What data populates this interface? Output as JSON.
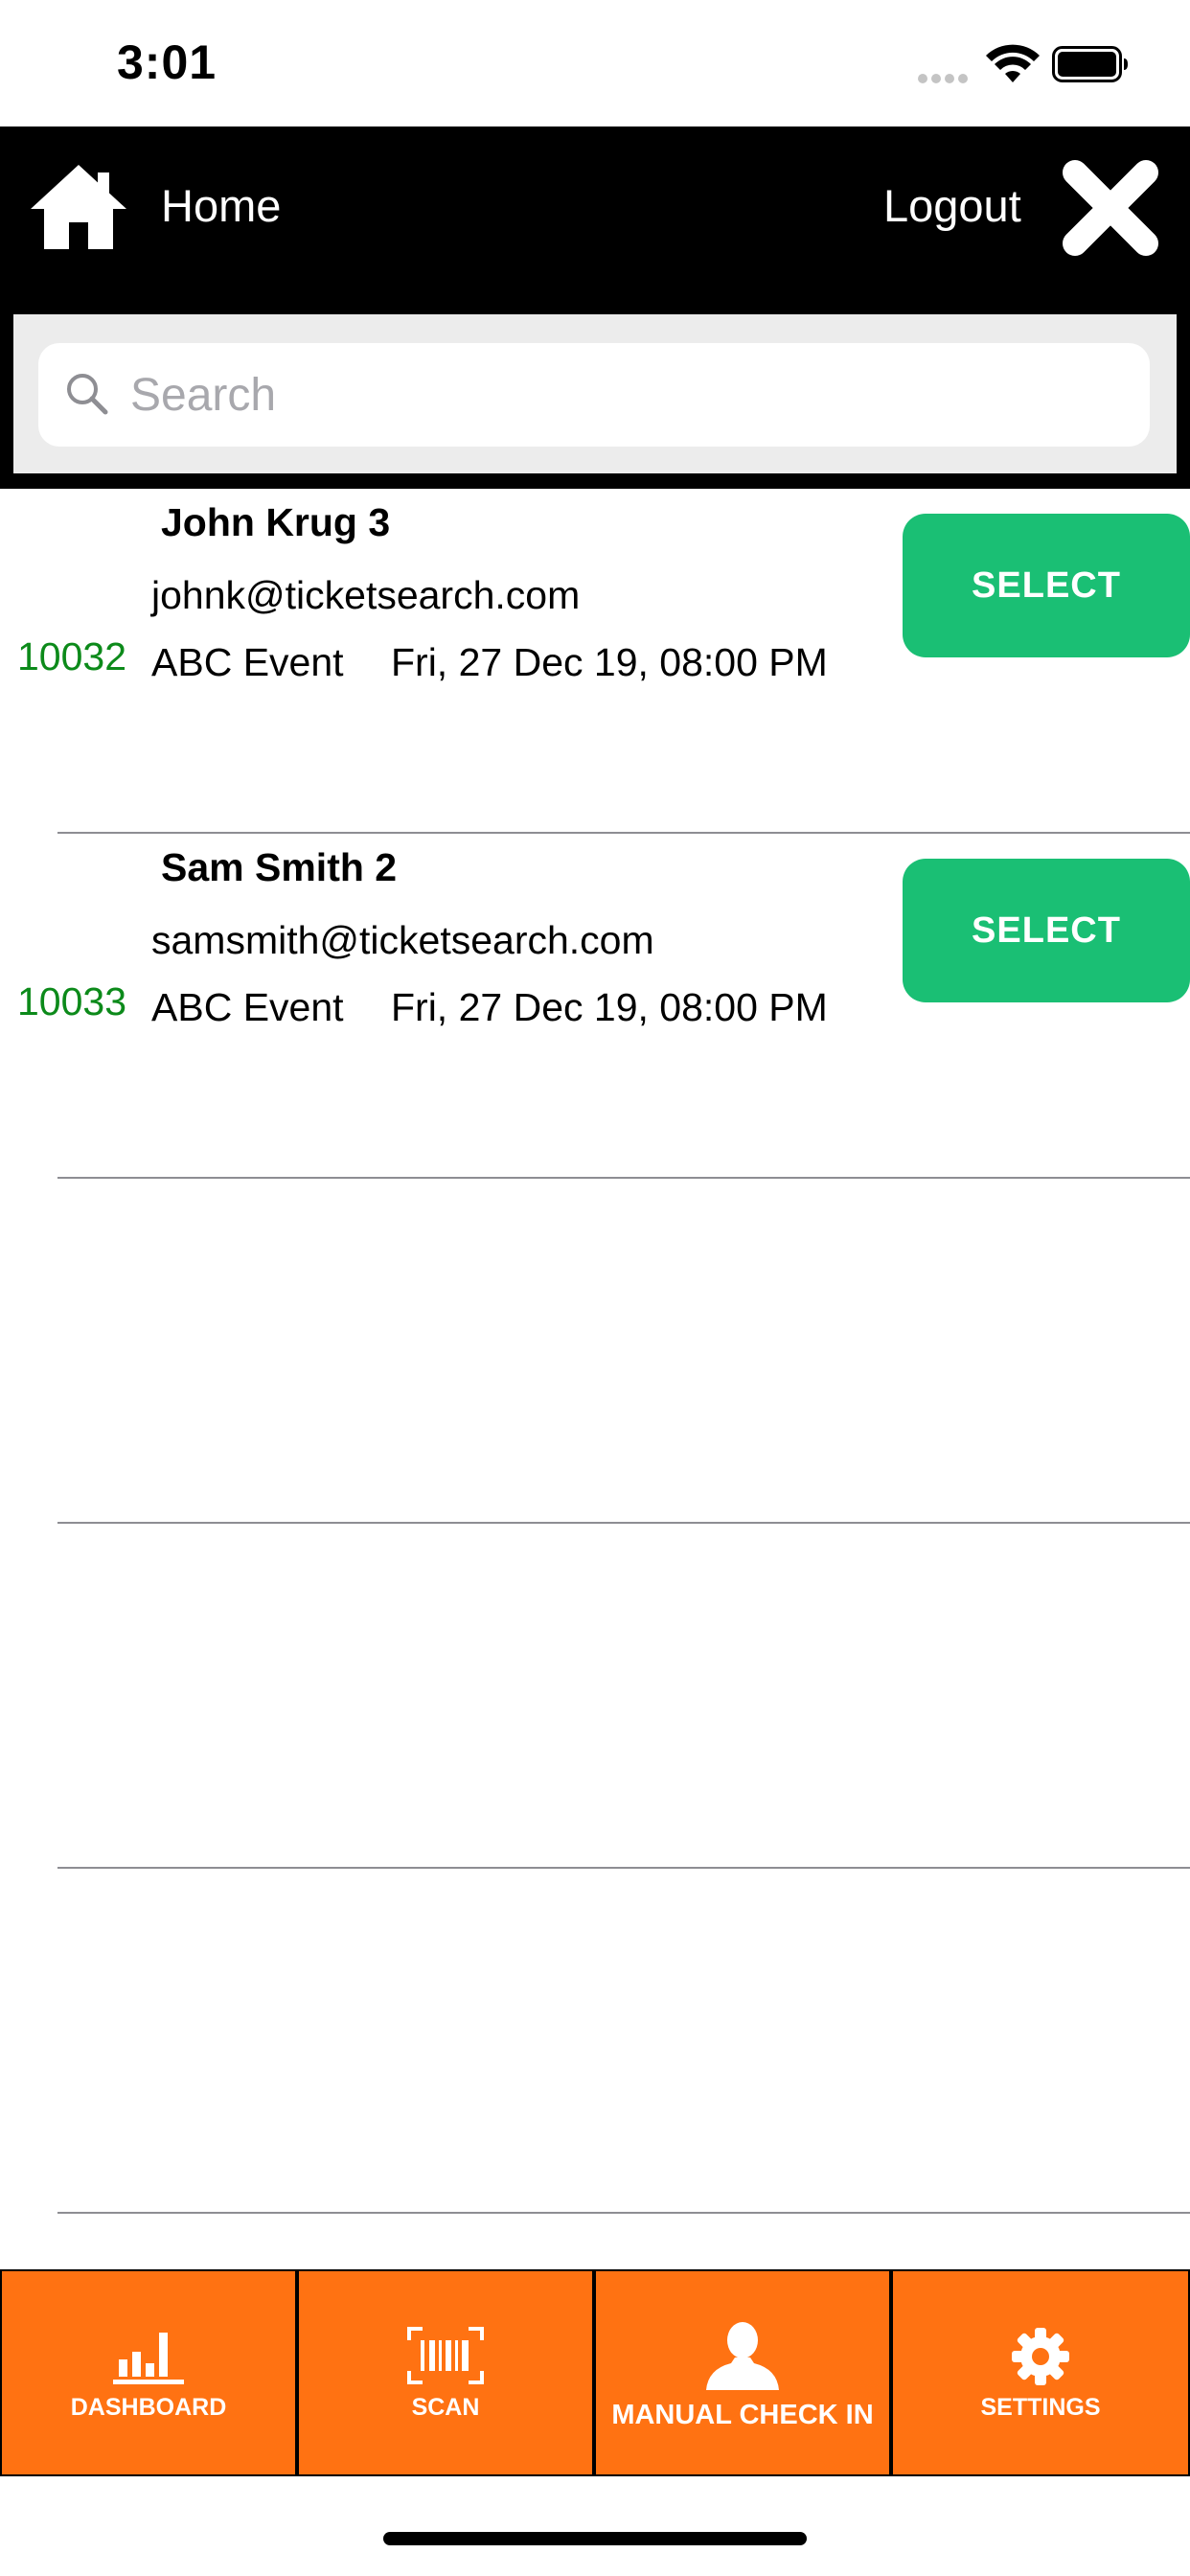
{
  "status_bar": {
    "time": "3:01"
  },
  "header": {
    "home_label": "Home",
    "logout_label": "Logout",
    "home_icon": "home-icon",
    "close_icon": "close-icon"
  },
  "search": {
    "placeholder": "Search",
    "value": ""
  },
  "results": [
    {
      "name": "John Krug 3",
      "email": "johnk@ticketsearch.com",
      "ticket_id": "10032",
      "event": "ABC Event",
      "date": "Fri, 27 Dec 19, 08:00 PM",
      "button_label": "SELECT"
    },
    {
      "name": "Sam Smith 2",
      "email": "samsmith@ticketsearch.com",
      "ticket_id": "10033",
      "event": "ABC Event",
      "date": "Fri, 27 Dec 19, 08:00 PM",
      "button_label": "SELECT"
    }
  ],
  "tab_bar": {
    "tabs": [
      {
        "label": "DASHBOARD",
        "icon": "bar-chart-icon"
      },
      {
        "label": "SCAN",
        "icon": "barcode-icon"
      },
      {
        "label": "MANUAL CHECK IN",
        "icon": "person-icon"
      },
      {
        "label": "SETTINGS",
        "icon": "gear-icon"
      }
    ]
  },
  "colors": {
    "header_bg": "#000000",
    "select_button": "#1abf74",
    "ticket_id_text": "#0c8a1a",
    "tab_bar_bg": "#ff7212"
  }
}
